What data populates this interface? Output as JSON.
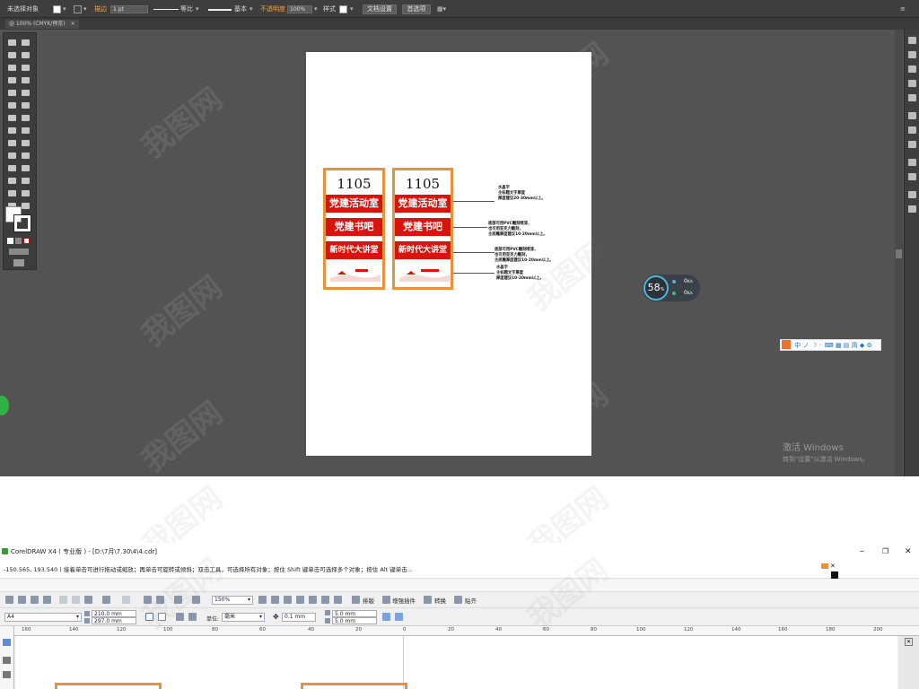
{
  "illustrator": {
    "control_bar": {
      "selection": "未选择对象",
      "stroke_label": "描边",
      "stroke_weight": "1 pt",
      "profile_1": "等比",
      "profile_2": "基本",
      "opacity_label": "不透明度",
      "opacity_value": "100%",
      "style_label": "样式",
      "doc_setup": "文档设置",
      "preferences": "首选项"
    },
    "doc_tab": "@ 100% (CMYK/预览)",
    "artboard": {
      "sign_left": {
        "number": "1105",
        "bars": [
          "党建活动室",
          "党建书吧",
          "新时代大讲堂"
        ]
      },
      "sign_right": {
        "number": "1105",
        "bars": [
          "党建活动室",
          "党建书吧",
          "新时代大讲堂"
        ]
      },
      "notes": [
        [
          "水晶字",
          "主标题文字厚度",
          "厚度建议20-30mm以上。"
        ],
        [
          "底部可用PVC雕刻喷漆，",
          "也可用亚克力雕刻，",
          "主底雕厚度建议10-20mm以上。"
        ],
        [
          "底部可用PVC雕刻喷漆，",
          "也可用亚克力雕刻，",
          "主底雕厚度建议10-20mm以上。"
        ],
        [
          "水晶字",
          "主标题文字厚度",
          "厚度建议10-20mm以上。"
        ]
      ]
    },
    "speed_widget": {
      "percent": "58",
      "unit": "%",
      "up": "0",
      "down": "0",
      "rate_unit": "K/s"
    },
    "ime_bar": {
      "label": "中",
      "items": [
        "ノ",
        "☽",
        "◦",
        "⌨",
        "▦",
        "▤",
        "简",
        "◆",
        "⚙"
      ]
    },
    "windows_activation": {
      "title": "激活 Windows",
      "subtitle": "转到\"设置\"以激活 Windows。"
    }
  },
  "watermark": "我图网",
  "coreldraw": {
    "title": "CorelDRAW X4 ( 专业版 ) - [D:\\7月\\7.30\\4\\4.cdr]",
    "status": "-150.565, 193.540 )   接着单击可进行拖动或缩放；再单击可旋转或倾斜；双击工具，可选择所有对象；按住 Shift 键单击可选择多个对象；按住 Alt 键单击...",
    "zoom": "150%",
    "toolbar_labels": [
      "排版",
      "增强插件",
      "转换",
      "贴齐"
    ],
    "page_size": "A4",
    "width": "210.0 mm",
    "height": "297.0 mm",
    "unit_label": "单位:",
    "unit": "毫米",
    "nudge": "0.1 mm",
    "dup_x": "5.0 mm",
    "dup_y": "5.0 mm",
    "ruler_ticks": [
      "160",
      "140",
      "120",
      "100",
      "80",
      "60",
      "40",
      "20",
      "0",
      "20",
      "40",
      "60",
      "80",
      "100",
      "120",
      "140",
      "160",
      "180",
      "200"
    ],
    "window_controls": [
      "–",
      "❐",
      "✕"
    ]
  }
}
